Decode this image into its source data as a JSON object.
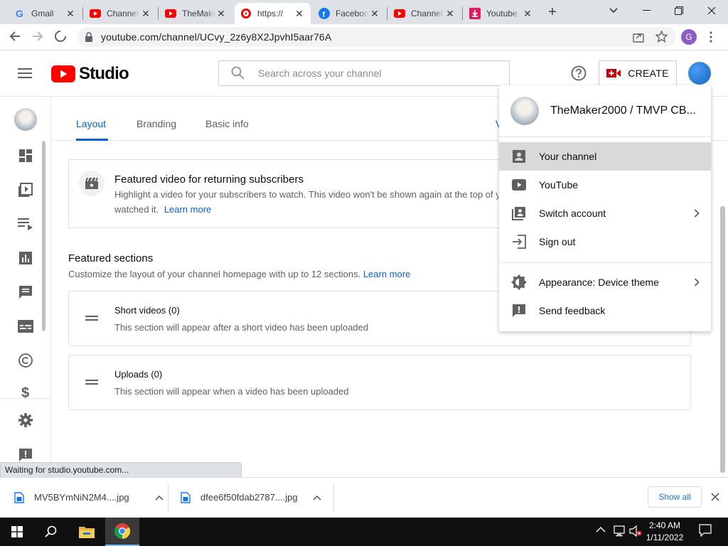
{
  "browser": {
    "tabs": [
      {
        "label": "Gmail",
        "icon": "gmail-icon"
      },
      {
        "label": "Channel",
        "icon": "youtube-icon"
      },
      {
        "label": "TheMaker",
        "icon": "youtube-icon"
      },
      {
        "label": "https://",
        "icon": "studio-icon"
      },
      {
        "label": "Facebook",
        "icon": "facebook-icon"
      },
      {
        "label": "Channel",
        "icon": "youtube-icon"
      },
      {
        "label": "Youtube",
        "icon": "download-icon"
      }
    ],
    "new_tab": "+",
    "url": "youtube.com/channel/UCvy_2z6y8X2JpvhI5aar76A",
    "profile_initial": "G"
  },
  "studio": {
    "logo_text": "Studio",
    "search_placeholder": "Search across your channel",
    "create_label": "CREATE"
  },
  "page_tabs": {
    "layout": "Layout",
    "branding": "Branding",
    "basic_info": "Basic info",
    "clipped": "V"
  },
  "featured_video": {
    "title": "Featured video for returning subscribers",
    "desc_line1": "Highlight a video for your subscribers to watch. This video won't be shown again at the top of y",
    "desc_line2": "watched it.",
    "learn_more": "Learn more"
  },
  "featured_sections": {
    "title": "Featured sections",
    "desc": "Customize the layout of your channel homepage with up to 12 sections.",
    "learn_more": "Learn more",
    "items": [
      {
        "name": "Short videos",
        "count": "(0)",
        "desc": "This section will appear after a short video has been uploaded"
      },
      {
        "name": "Uploads",
        "count": "(0)",
        "desc": "This section will appear when a video has been uploaded"
      }
    ]
  },
  "account_menu": {
    "name": "TheMaker2000 / TMVP CB...",
    "items": [
      {
        "label": "Your channel",
        "icon": "person-box-icon",
        "highlighted": true
      },
      {
        "label": "YouTube",
        "icon": "youtube-icon"
      },
      {
        "label": "Switch account",
        "icon": "switch-account-icon",
        "chevron": true
      },
      {
        "label": "Sign out",
        "icon": "sign-out-icon"
      }
    ],
    "items2": [
      {
        "label": "Appearance: Device theme",
        "icon": "appearance-icon",
        "chevron": true
      },
      {
        "label": "Send feedback",
        "icon": "feedback-icon"
      }
    ]
  },
  "status_text": "Waiting for studio.youtube.com...",
  "downloads": {
    "items": [
      {
        "name": "MV5BYmNiN2M4....jpg"
      },
      {
        "name": "dfee6f50fdab2787....jpg"
      }
    ],
    "show_all": "Show all"
  },
  "taskbar": {
    "time": "2:40 AM",
    "date": "1/11/2022"
  },
  "colors": {
    "youtube_red": "#ff0000",
    "studio_blue": "#065fd4",
    "menu_highlight": "#d9d9d9"
  }
}
